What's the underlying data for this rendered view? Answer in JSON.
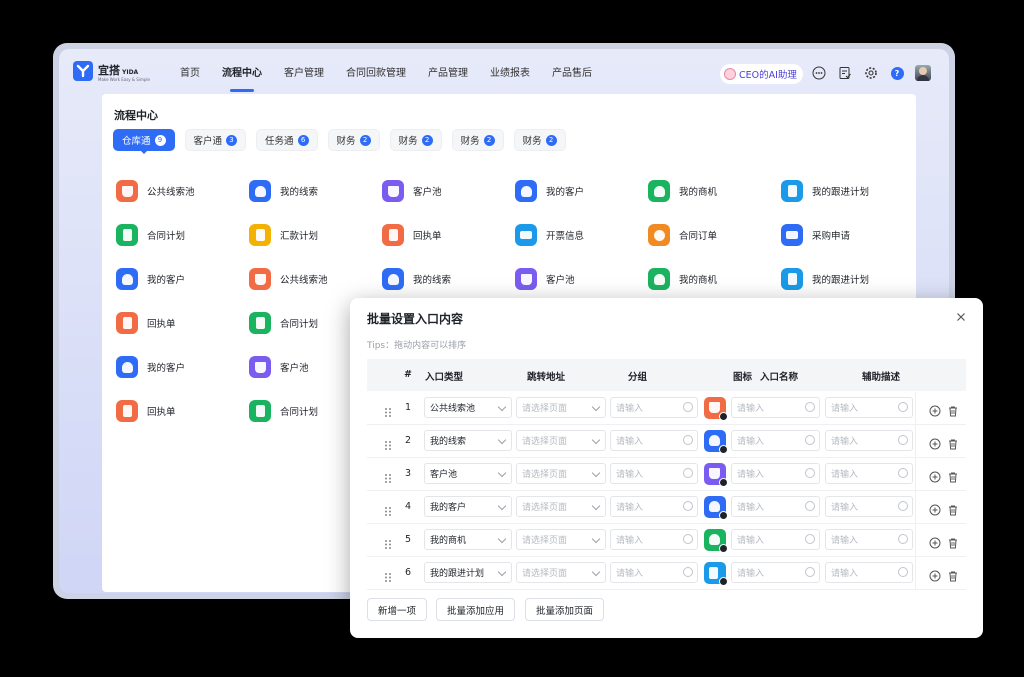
{
  "app": {
    "logo_cn": "宜搭",
    "logo_en": "YIDA",
    "logo_sub": "Make Work Easy & Simple",
    "nav": [
      "首页",
      "流程中心",
      "客户管理",
      "合同回款管理",
      "产品管理",
      "业绩报表",
      "产品售后"
    ],
    "active_nav": "流程中心",
    "ai_button": "CEO的AI助理",
    "icons": [
      "more-icon",
      "todo-icon",
      "gear-icon",
      "help-icon",
      "user-avatar"
    ]
  },
  "panel": {
    "title": "流程中心",
    "tabs": [
      {
        "label": "仓库通",
        "count": "9"
      },
      {
        "label": "客户通",
        "count": "3"
      },
      {
        "label": "任务通",
        "count": "6"
      },
      {
        "label": "财务",
        "count": "2"
      },
      {
        "label": "财务",
        "count": "2"
      },
      {
        "label": "财务",
        "count": "2"
      },
      {
        "label": "财务",
        "count": "2"
      }
    ],
    "active_tab": 0,
    "items": [
      {
        "label": "公共线索池",
        "icon": "basket-icon",
        "color": "#f16c45"
      },
      {
        "label": "我的线索",
        "icon": "person-icon",
        "color": "#2f6cf6"
      },
      {
        "label": "客户池",
        "icon": "basket-icon",
        "color": "#7b5cf0"
      },
      {
        "label": "我的客户",
        "icon": "people-icon",
        "color": "#2f6cf6"
      },
      {
        "label": "我的商机",
        "icon": "person-icon",
        "color": "#1ab35f"
      },
      {
        "label": "我的跟进计划",
        "icon": "calendar-icon",
        "color": "#1a9ae8"
      },
      {
        "label": "合同计划",
        "icon": "document-icon",
        "color": "#1ab35f"
      },
      {
        "label": "汇款计划",
        "icon": "document-icon",
        "color": "#f5b100"
      },
      {
        "label": "回执单",
        "icon": "receipt-icon",
        "color": "#f16c45"
      },
      {
        "label": "开票信息",
        "icon": "card-icon",
        "color": "#1a9ae8"
      },
      {
        "label": "合同订单",
        "icon": "piggy-bank-icon",
        "color": "#f28a22"
      },
      {
        "label": "采购申请",
        "icon": "stack-icon",
        "color": "#2f6cf6"
      },
      {
        "label": "我的客户",
        "icon": "people-icon",
        "color": "#2f6cf6"
      },
      {
        "label": "公共线索池",
        "icon": "basket-icon",
        "color": "#f16c45"
      },
      {
        "label": "我的线索",
        "icon": "person-icon",
        "color": "#2f6cf6"
      },
      {
        "label": "客户池",
        "icon": "basket-icon",
        "color": "#7b5cf0"
      },
      {
        "label": "我的商机",
        "icon": "person-icon",
        "color": "#1ab35f"
      },
      {
        "label": "我的跟进计划",
        "icon": "calendar-icon",
        "color": "#1a9ae8"
      },
      {
        "label": "回执单",
        "icon": "receipt-icon",
        "color": "#f16c45"
      },
      {
        "label": "合同计划",
        "icon": "document-icon",
        "color": "#1ab35f"
      },
      {
        "label": "",
        "icon": "",
        "color": ""
      },
      {
        "label": "",
        "icon": "",
        "color": ""
      },
      {
        "label": "",
        "icon": "",
        "color": ""
      },
      {
        "label": "",
        "icon": "",
        "color": ""
      },
      {
        "label": "我的客户",
        "icon": "people-icon",
        "color": "#2f6cf6"
      },
      {
        "label": "客户池",
        "icon": "basket-icon",
        "color": "#7b5cf0"
      },
      {
        "label": "",
        "icon": "",
        "color": ""
      },
      {
        "label": "",
        "icon": "",
        "color": ""
      },
      {
        "label": "",
        "icon": "",
        "color": ""
      },
      {
        "label": "",
        "icon": "",
        "color": ""
      },
      {
        "label": "回执单",
        "icon": "receipt-icon",
        "color": "#f16c45"
      },
      {
        "label": "合同计划",
        "icon": "document-icon",
        "color": "#1ab35f"
      }
    ]
  },
  "dialog": {
    "title": "批量设置入口内容",
    "tips": "Tips：拖动内容可以排序",
    "columns": {
      "num": "#",
      "type": "入口类型",
      "url": "跳转地址",
      "group": "分组",
      "icon": "图标",
      "name": "入口名称",
      "desc": "辅助描述"
    },
    "url_placeholder": "请选择页面",
    "input_placeholder": "请输入",
    "rows": [
      {
        "num": "1",
        "type": "公共线索池",
        "icon": "basket-icon",
        "color": "#f16c45"
      },
      {
        "num": "2",
        "type": "我的线索",
        "icon": "person-icon",
        "color": "#2f6cf6"
      },
      {
        "num": "3",
        "type": "客户池",
        "icon": "basket-icon",
        "color": "#7b5cf0"
      },
      {
        "num": "4",
        "type": "我的客户",
        "icon": "people-icon",
        "color": "#2f6cf6"
      },
      {
        "num": "5",
        "type": "我的商机",
        "icon": "person-icon",
        "color": "#1ab35f"
      },
      {
        "num": "6",
        "type": "我的跟进计划",
        "icon": "calendar-icon",
        "color": "#1a9ae8"
      }
    ],
    "buttons": {
      "add_one": "新增一项",
      "batch_app": "批量添加应用",
      "batch_page": "批量添加页面"
    }
  }
}
